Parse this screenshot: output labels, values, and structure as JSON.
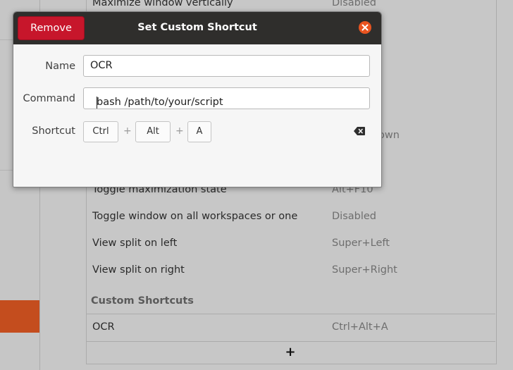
{
  "background": {
    "rows": [
      {
        "name": "Maximize window vertically",
        "accel": "Disabled"
      },
      {
        "name": "Toggle maximization state",
        "accel": "Alt+F10"
      },
      {
        "name": "Toggle window on all workspaces or one",
        "accel": "Disabled"
      },
      {
        "name": "View split on left",
        "accel": "Super+Left"
      },
      {
        "name": "View split on right",
        "accel": "Super+Right"
      }
    ],
    "hidden_partial_accel": "own",
    "custom_section_title": "Custom Shortcuts",
    "custom_rows": [
      {
        "name": "OCR",
        "accel": "Ctrl+Alt+A"
      }
    ],
    "add_label": "+"
  },
  "dialog": {
    "title": "Set Custom Shortcut",
    "remove_label": "Remove",
    "name_label": "Name",
    "name_value": "OCR",
    "command_label": "Command",
    "command_value": "bash /path/to/your/script",
    "shortcut_label": "Shortcut",
    "keys": [
      "Ctrl",
      "Alt",
      "A"
    ],
    "plus": "+"
  },
  "icons": {
    "close": "close-icon",
    "backspace": "backspace-icon",
    "add": "add-icon"
  },
  "colors": {
    "accent": "#e95420",
    "destructive": "#c7162b",
    "selected_sidebar": "#c44d1e",
    "titlebar": "#2f2e2c"
  }
}
